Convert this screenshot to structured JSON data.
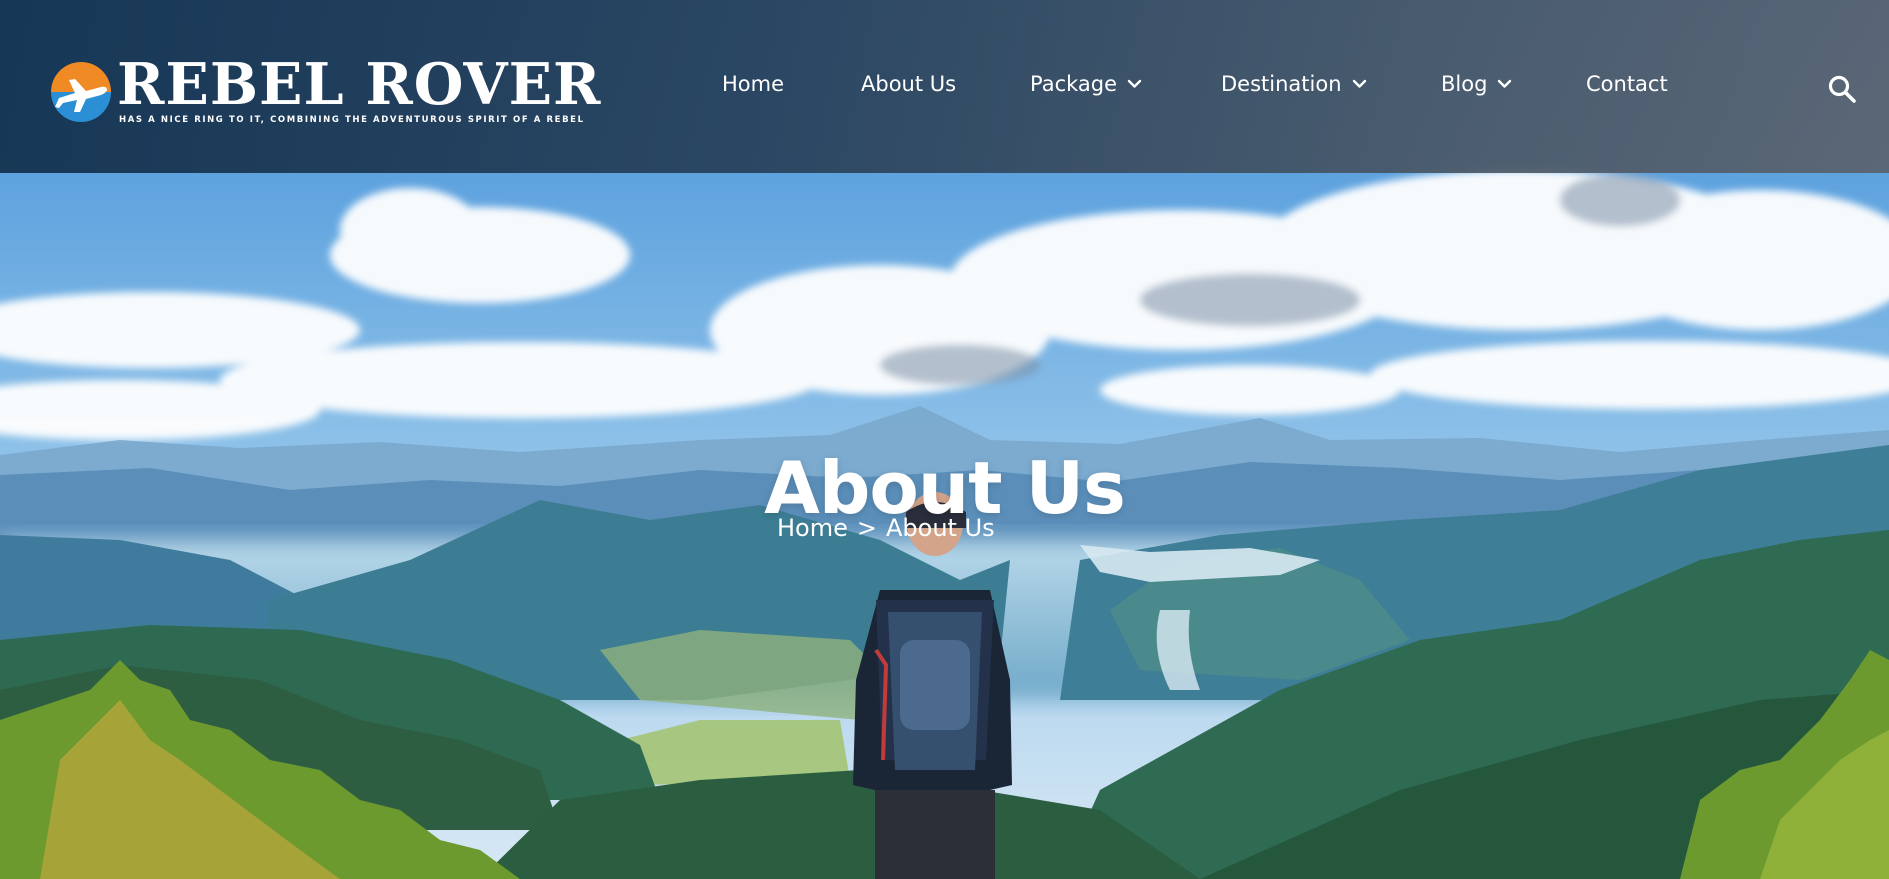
{
  "brand": {
    "name": "REBEL ROVER",
    "tagline": "HAS A NICE RING TO IT, COMBINING THE ADVENTUROUS SPIRIT OF A REBEL",
    "logo_icon": "airplane-icon"
  },
  "nav": {
    "items": [
      {
        "label": "Home",
        "dropdown": false
      },
      {
        "label": "About Us",
        "dropdown": false
      },
      {
        "label": "Package",
        "dropdown": true
      },
      {
        "label": "Destination",
        "dropdown": true
      },
      {
        "label": "Blog",
        "dropdown": true
      },
      {
        "label": "Contact",
        "dropdown": false
      }
    ],
    "search_icon": "search-icon"
  },
  "hero": {
    "title": "About Us",
    "breadcrumb": {
      "home": "Home",
      "separator": ">",
      "current": "About Us"
    }
  },
  "colors": {
    "header_bg": "#1e3a57",
    "text": "#ffffff",
    "logo_orange": "#f08a24",
    "logo_blue": "#2b8fd6"
  }
}
